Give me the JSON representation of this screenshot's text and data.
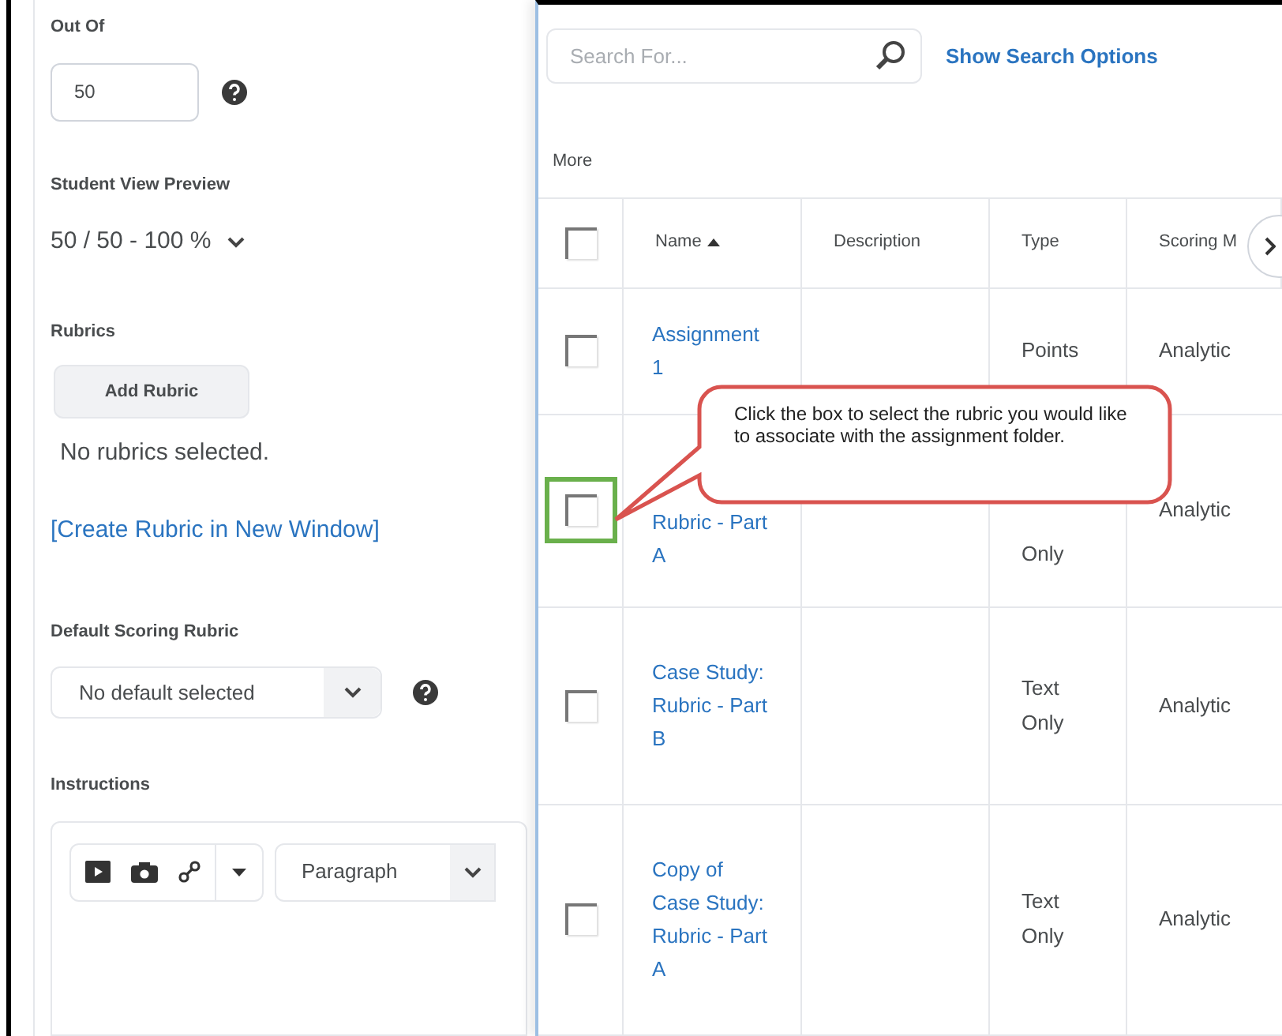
{
  "form": {
    "out_of": {
      "label": "Out Of",
      "value": "50"
    },
    "preview": {
      "label": "Student View Preview",
      "value": "50 / 50 - 100 %"
    },
    "rubrics": {
      "label": "Rubrics",
      "button": "Add Rubric",
      "empty_text": "No rubrics selected.",
      "link": "[Create Rubric in New Window]"
    },
    "default_scoring": {
      "label": "Default Scoring Rubric",
      "value": "No default selected"
    },
    "instructions": {
      "label": "Instructions",
      "format": "Paragraph"
    }
  },
  "rubric_picker": {
    "search": {
      "placeholder": "Search For...",
      "options_link": "Show Search Options"
    },
    "more": "More",
    "header_checked": false,
    "columns": [
      {
        "label": "Name",
        "sorted": true
      },
      {
        "label": "Description",
        "sorted": false
      },
      {
        "label": "Type",
        "sorted": false
      },
      {
        "label": "Scoring M",
        "sorted": false
      }
    ],
    "rows": [
      {
        "name": "Assignment 1",
        "type": "Points",
        "scoring": "Analytic",
        "checked": false,
        "highlighted": false
      },
      {
        "name": "Rubric - Part A",
        "type": "Only",
        "scoring": "Analytic",
        "checked": false,
        "highlighted": true
      },
      {
        "name": "Case Study: Rubric - Part B",
        "type": "Text Only",
        "scoring": "Analytic",
        "checked": false,
        "highlighted": false
      },
      {
        "name": "Copy of Case Study: Rubric - Part A",
        "type": "Text Only",
        "scoring": "Analytic",
        "checked": false,
        "highlighted": false
      }
    ]
  },
  "callout": {
    "text": "Click the box to select the rubric you would like to associate with the assignment folder."
  }
}
